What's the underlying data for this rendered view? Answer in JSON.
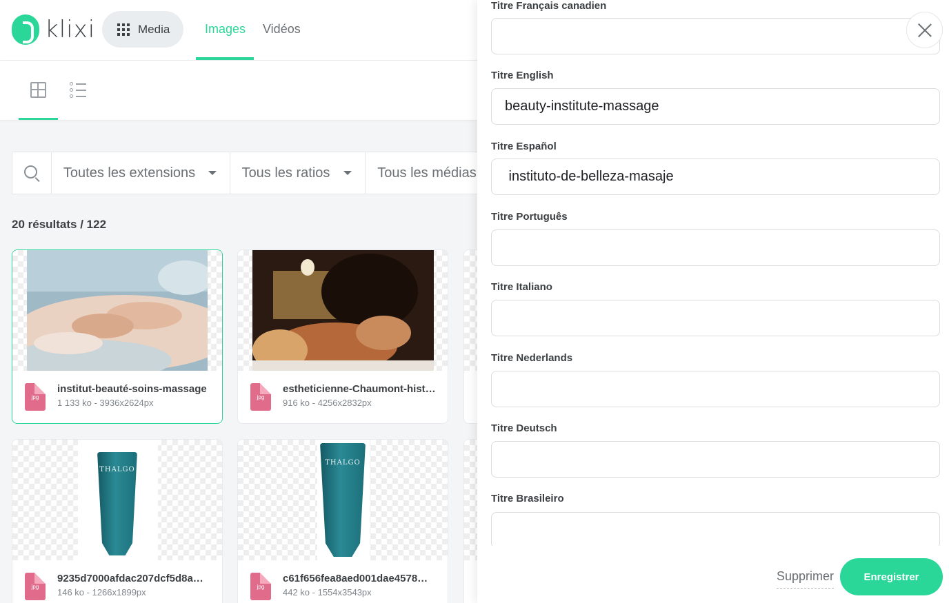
{
  "app": {
    "logo_text": "klixi",
    "brand_color": "#2bd699"
  },
  "header": {
    "media_button_label": "Media",
    "tabs": [
      {
        "label": "Images",
        "active": true
      },
      {
        "label": "Vidéos",
        "active": false
      }
    ]
  },
  "view_toggle": {
    "active": "grid"
  },
  "filters": {
    "extensions": "Toutes les extensions",
    "ratios": "Tous les ratios",
    "medias": "Tous les médias"
  },
  "results_text": "20 résultats / 122",
  "cards": [
    {
      "name": "institut-beauté-soins-massage",
      "meta": "1 133 ko - 3936x2624px",
      "ext": "jpg",
      "selected": true
    },
    {
      "name": "estheticienne-Chaumont-hist…",
      "meta": "916 ko - 4256x2832px",
      "ext": "jpg",
      "selected": false
    },
    {
      "name": "9235d7000afdac207dcf5d8a…",
      "meta": "146 ko - 1266x1899px",
      "ext": "jpg",
      "selected": false,
      "product_label": "THALGO"
    },
    {
      "name": "c61f656fea8aed001dae4578…",
      "meta": "442 ko - 1554x3543px",
      "ext": "jpg",
      "selected": false,
      "product_label": "THALGO"
    }
  ],
  "panel": {
    "fields": [
      {
        "label": "Titre Français canadien",
        "value": ""
      },
      {
        "label": "Titre English",
        "value": "beauty-institute-massage"
      },
      {
        "label": "Titre Español",
        "value": " instituto-de-belleza-masaje"
      },
      {
        "label": "Titre Português",
        "value": ""
      },
      {
        "label": "Titre Italiano",
        "value": ""
      },
      {
        "label": "Titre Nederlands",
        "value": ""
      },
      {
        "label": "Titre Deutsch",
        "value": ""
      },
      {
        "label": "Titre Brasileiro",
        "value": ""
      }
    ],
    "delete_label": "Supprimer",
    "save_label": "Enregistrer"
  }
}
